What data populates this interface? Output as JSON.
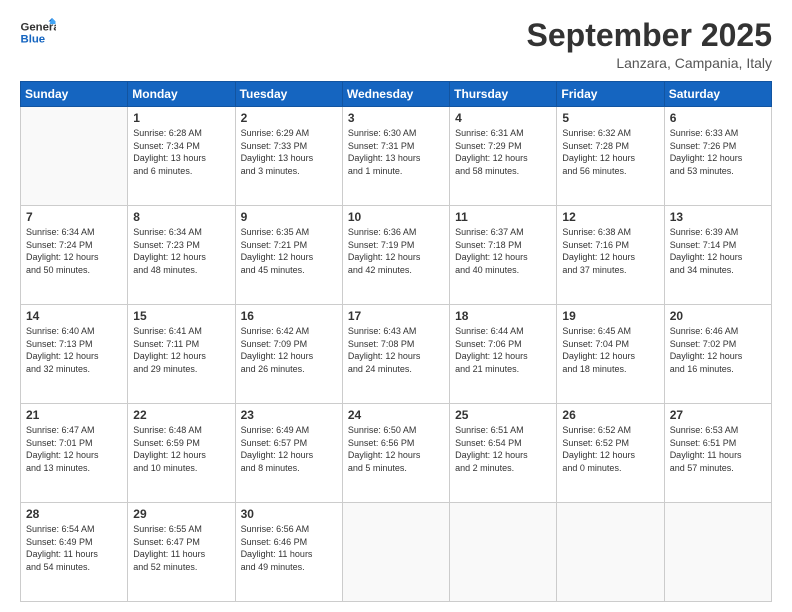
{
  "header": {
    "logo_line1": "General",
    "logo_line2": "Blue",
    "month": "September 2025",
    "location": "Lanzara, Campania, Italy"
  },
  "weekdays": [
    "Sunday",
    "Monday",
    "Tuesday",
    "Wednesday",
    "Thursday",
    "Friday",
    "Saturday"
  ],
  "weeks": [
    [
      {
        "day": "",
        "info": ""
      },
      {
        "day": "1",
        "info": "Sunrise: 6:28 AM\nSunset: 7:34 PM\nDaylight: 13 hours\nand 6 minutes."
      },
      {
        "day": "2",
        "info": "Sunrise: 6:29 AM\nSunset: 7:33 PM\nDaylight: 13 hours\nand 3 minutes."
      },
      {
        "day": "3",
        "info": "Sunrise: 6:30 AM\nSunset: 7:31 PM\nDaylight: 13 hours\nand 1 minute."
      },
      {
        "day": "4",
        "info": "Sunrise: 6:31 AM\nSunset: 7:29 PM\nDaylight: 12 hours\nand 58 minutes."
      },
      {
        "day": "5",
        "info": "Sunrise: 6:32 AM\nSunset: 7:28 PM\nDaylight: 12 hours\nand 56 minutes."
      },
      {
        "day": "6",
        "info": "Sunrise: 6:33 AM\nSunset: 7:26 PM\nDaylight: 12 hours\nand 53 minutes."
      }
    ],
    [
      {
        "day": "7",
        "info": "Sunrise: 6:34 AM\nSunset: 7:24 PM\nDaylight: 12 hours\nand 50 minutes."
      },
      {
        "day": "8",
        "info": "Sunrise: 6:34 AM\nSunset: 7:23 PM\nDaylight: 12 hours\nand 48 minutes."
      },
      {
        "day": "9",
        "info": "Sunrise: 6:35 AM\nSunset: 7:21 PM\nDaylight: 12 hours\nand 45 minutes."
      },
      {
        "day": "10",
        "info": "Sunrise: 6:36 AM\nSunset: 7:19 PM\nDaylight: 12 hours\nand 42 minutes."
      },
      {
        "day": "11",
        "info": "Sunrise: 6:37 AM\nSunset: 7:18 PM\nDaylight: 12 hours\nand 40 minutes."
      },
      {
        "day": "12",
        "info": "Sunrise: 6:38 AM\nSunset: 7:16 PM\nDaylight: 12 hours\nand 37 minutes."
      },
      {
        "day": "13",
        "info": "Sunrise: 6:39 AM\nSunset: 7:14 PM\nDaylight: 12 hours\nand 34 minutes."
      }
    ],
    [
      {
        "day": "14",
        "info": "Sunrise: 6:40 AM\nSunset: 7:13 PM\nDaylight: 12 hours\nand 32 minutes."
      },
      {
        "day": "15",
        "info": "Sunrise: 6:41 AM\nSunset: 7:11 PM\nDaylight: 12 hours\nand 29 minutes."
      },
      {
        "day": "16",
        "info": "Sunrise: 6:42 AM\nSunset: 7:09 PM\nDaylight: 12 hours\nand 26 minutes."
      },
      {
        "day": "17",
        "info": "Sunrise: 6:43 AM\nSunset: 7:08 PM\nDaylight: 12 hours\nand 24 minutes."
      },
      {
        "day": "18",
        "info": "Sunrise: 6:44 AM\nSunset: 7:06 PM\nDaylight: 12 hours\nand 21 minutes."
      },
      {
        "day": "19",
        "info": "Sunrise: 6:45 AM\nSunset: 7:04 PM\nDaylight: 12 hours\nand 18 minutes."
      },
      {
        "day": "20",
        "info": "Sunrise: 6:46 AM\nSunset: 7:02 PM\nDaylight: 12 hours\nand 16 minutes."
      }
    ],
    [
      {
        "day": "21",
        "info": "Sunrise: 6:47 AM\nSunset: 7:01 PM\nDaylight: 12 hours\nand 13 minutes."
      },
      {
        "day": "22",
        "info": "Sunrise: 6:48 AM\nSunset: 6:59 PM\nDaylight: 12 hours\nand 10 minutes."
      },
      {
        "day": "23",
        "info": "Sunrise: 6:49 AM\nSunset: 6:57 PM\nDaylight: 12 hours\nand 8 minutes."
      },
      {
        "day": "24",
        "info": "Sunrise: 6:50 AM\nSunset: 6:56 PM\nDaylight: 12 hours\nand 5 minutes."
      },
      {
        "day": "25",
        "info": "Sunrise: 6:51 AM\nSunset: 6:54 PM\nDaylight: 12 hours\nand 2 minutes."
      },
      {
        "day": "26",
        "info": "Sunrise: 6:52 AM\nSunset: 6:52 PM\nDaylight: 12 hours\nand 0 minutes."
      },
      {
        "day": "27",
        "info": "Sunrise: 6:53 AM\nSunset: 6:51 PM\nDaylight: 11 hours\nand 57 minutes."
      }
    ],
    [
      {
        "day": "28",
        "info": "Sunrise: 6:54 AM\nSunset: 6:49 PM\nDaylight: 11 hours\nand 54 minutes."
      },
      {
        "day": "29",
        "info": "Sunrise: 6:55 AM\nSunset: 6:47 PM\nDaylight: 11 hours\nand 52 minutes."
      },
      {
        "day": "30",
        "info": "Sunrise: 6:56 AM\nSunset: 6:46 PM\nDaylight: 11 hours\nand 49 minutes."
      },
      {
        "day": "",
        "info": ""
      },
      {
        "day": "",
        "info": ""
      },
      {
        "day": "",
        "info": ""
      },
      {
        "day": "",
        "info": ""
      }
    ]
  ]
}
